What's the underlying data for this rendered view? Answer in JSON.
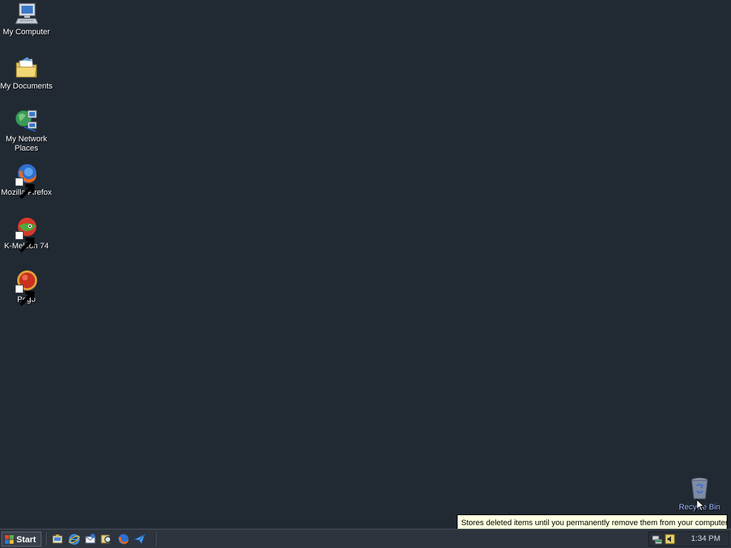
{
  "desktop": {
    "icons": [
      {
        "label": "My Computer",
        "icon": "my-computer-icon"
      },
      {
        "label": "My Documents",
        "icon": "my-documents-icon"
      },
      {
        "label": "My Network Places",
        "icon": "network-places-icon"
      },
      {
        "label": "Mozilla Firefox",
        "icon": "firefox-icon"
      },
      {
        "label": "K-Meleon 74",
        "icon": "kmeleon-icon"
      },
      {
        "label": "Pego",
        "icon": "pego-icon"
      }
    ],
    "recycle_bin": {
      "label": "Recycle Bin",
      "icon": "recycle-bin-icon"
    },
    "tooltip": "Stores deleted items until you permanently remove them from your computer"
  },
  "taskbar": {
    "start_label": "Start",
    "quick_launch": [
      "show-desktop-icon",
      "internet-explorer-icon",
      "outlook-express-icon",
      "search-icon",
      "firefox-icon",
      "send-icon"
    ],
    "tray_icons": [
      "network-icon",
      "volume-icon"
    ],
    "clock": "1:34 PM"
  },
  "colors": {
    "desktop": "#212932",
    "taskbar": "#2d343d",
    "tooltip_bg": "#ffffe1"
  }
}
